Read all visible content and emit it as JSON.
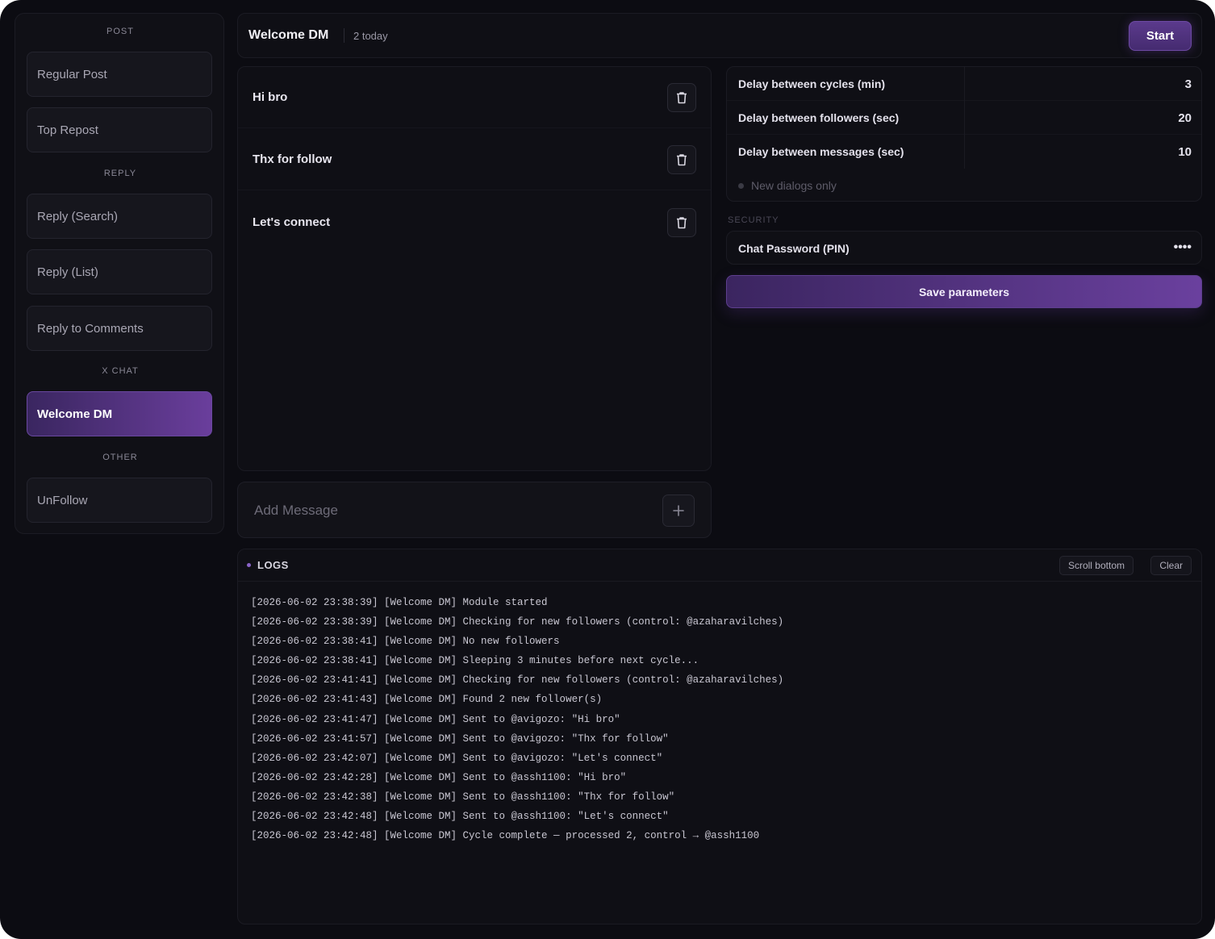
{
  "sidebar": {
    "sections": {
      "post": "POST",
      "reply": "REPLY",
      "x_chat": "X CHAT",
      "other": "OTHER"
    },
    "items": [
      {
        "label": "Regular Post"
      },
      {
        "label": "Top Repost"
      },
      {
        "label": "Reply (Search)"
      },
      {
        "label": "Reply (List)"
      },
      {
        "label": "Reply to Comments"
      },
      {
        "label": "Welcome DM",
        "active": true
      },
      {
        "label": "UnFollow"
      }
    ]
  },
  "header": {
    "title": "Welcome DM",
    "count": "2 today",
    "start_label": "Start"
  },
  "messages": [
    {
      "text": "Hi bro"
    },
    {
      "text": "Thx for follow"
    },
    {
      "text": "Let's connect"
    }
  ],
  "add_message": {
    "placeholder": "Add Message",
    "add_icon": "plus-icon"
  },
  "params": [
    {
      "label": "Delay between cycles (min)",
      "value": "3"
    },
    {
      "label": "Delay between followers (sec)",
      "value": "20"
    },
    {
      "label": "Delay between messages (sec)",
      "value": "10"
    }
  ],
  "new_dialogs_label": "New dialogs only",
  "security": {
    "section_label": "SECURITY",
    "pin_label": "Chat Password (PIN)",
    "pin_value": "••••"
  },
  "save_label": "Save parameters",
  "logs": {
    "title": "LOGS",
    "scroll_label": "Scroll bottom",
    "clear_label": "Clear",
    "lines": [
      "[2026-06-02 23:38:39] [Welcome DM] Module started",
      "[2026-06-02 23:38:39] [Welcome DM] Checking for new followers (control: @azaharavilches)",
      "[2026-06-02 23:38:41] [Welcome DM] No new followers",
      "[2026-06-02 23:38:41] [Welcome DM] Sleeping 3 minutes before next cycle...",
      "[2026-06-02 23:41:41] [Welcome DM] Checking for new followers (control: @azaharavilches)",
      "[2026-06-02 23:41:43] [Welcome DM] Found 2 new follower(s)",
      "[2026-06-02 23:41:47] [Welcome DM] Sent to @avigozo: \"Hi bro\"",
      "[2026-06-02 23:41:57] [Welcome DM] Sent to @avigozo: \"Thx for follow\"",
      "[2026-06-02 23:42:07] [Welcome DM] Sent to @avigozo: \"Let's connect\"",
      "[2026-06-02 23:42:28] [Welcome DM] Sent to @assh1100: \"Hi bro\"",
      "[2026-06-02 23:42:38] [Welcome DM] Sent to @assh1100: \"Thx for follow\"",
      "[2026-06-02 23:42:48] [Welcome DM] Sent to @assh1100: \"Let's connect\"",
      "[2026-06-02 23:42:48] [Welcome DM] Cycle complete — processed 2, control → @assh1100"
    ]
  },
  "colors": {
    "accent": "#6a3e9c",
    "background": "#0c0c12",
    "panel": "#0f0f15"
  }
}
